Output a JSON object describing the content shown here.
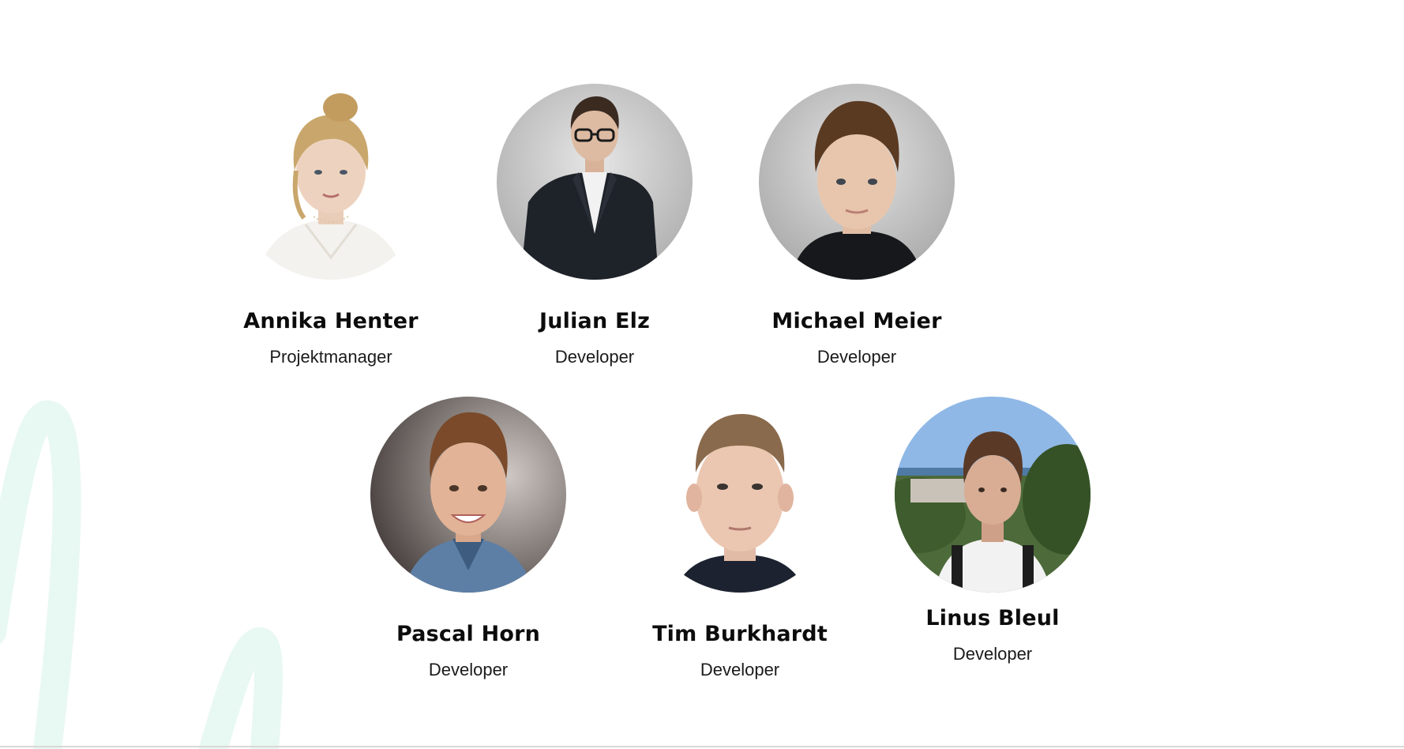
{
  "team": [
    {
      "name": "Annika Henter",
      "role": "Projektmanager"
    },
    {
      "name": "Julian Elz",
      "role": "Developer"
    },
    {
      "name": "Michael Meier",
      "role": "Developer"
    },
    {
      "name": "Pascal Horn",
      "role": "Developer"
    },
    {
      "name": "Tim Burkhardt",
      "role": "Developer"
    },
    {
      "name": "Linus Bleul",
      "role": "Developer"
    }
  ],
  "colors": {
    "accent_decoration": "#e8f8f2",
    "text": "#0c0c0c"
  }
}
